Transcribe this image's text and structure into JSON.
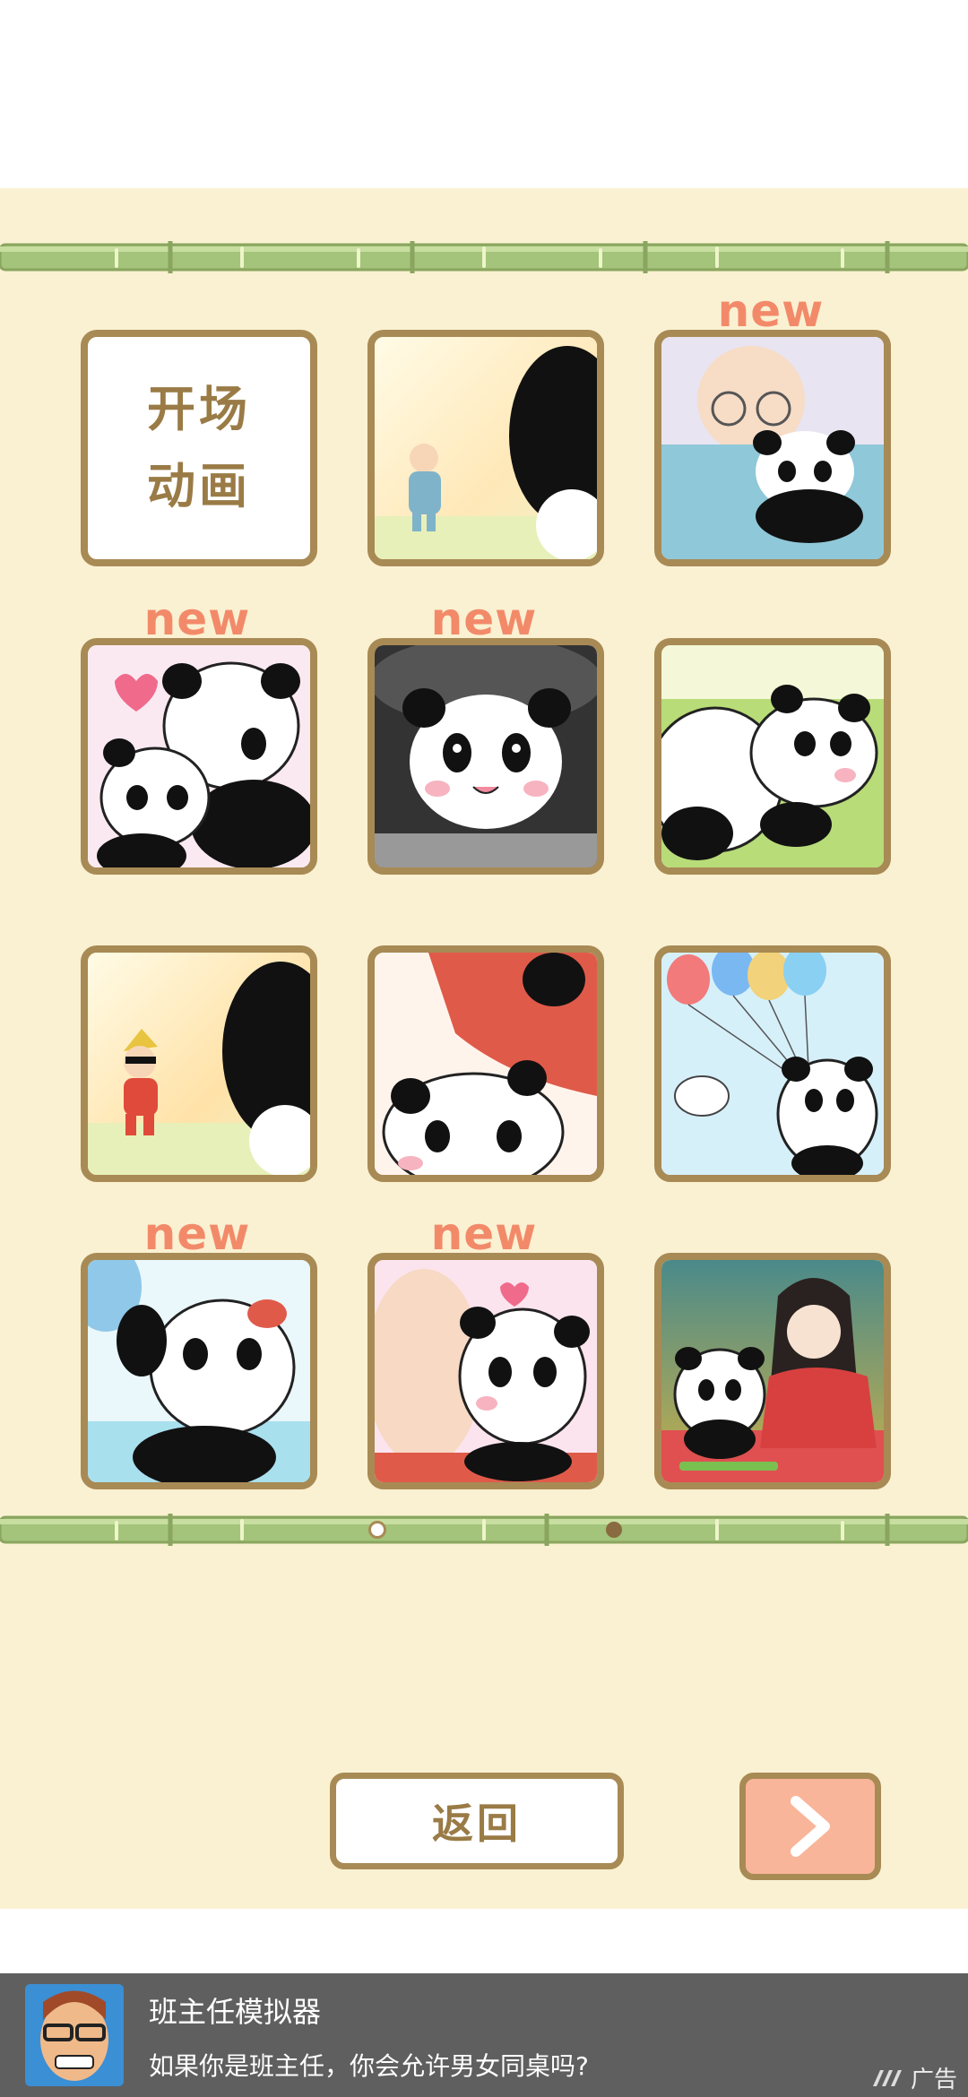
{
  "gallery": {
    "opening_tile_label": "开场动画",
    "opening_tile_line1": "开场",
    "opening_tile_line2": "动画",
    "new_badge": "new",
    "tiles": [
      {
        "id": "opening-animation",
        "is_new": false
      },
      {
        "id": "old-man-waving",
        "is_new": false
      },
      {
        "id": "old-man-hugging-panda",
        "is_new": true
      },
      {
        "id": "panda-mother-baby",
        "is_new": true
      },
      {
        "id": "panda-in-car",
        "is_new": true
      },
      {
        "id": "panda-lying-grass",
        "is_new": false
      },
      {
        "id": "guy-sunglasses-waving",
        "is_new": false
      },
      {
        "id": "panda-red-jacket",
        "is_new": false
      },
      {
        "id": "panda-balloons-bird",
        "is_new": false
      },
      {
        "id": "panda-sweating-leaf",
        "is_new": true
      },
      {
        "id": "panda-kiss",
        "is_new": true
      },
      {
        "id": "panda-kimono-girl",
        "is_new": false
      }
    ],
    "pagination": {
      "total": 2,
      "current": 1
    }
  },
  "nav": {
    "back_label": "返回",
    "next_icon": "chevron-right-icon"
  },
  "ad": {
    "title": "班主任模拟器",
    "text": "如果你是班主任，你会允许男女同桌吗?",
    "tag": "广告"
  },
  "colors": {
    "background": "#faf1d2",
    "frame": "#a88a55",
    "new_badge": "#f28a6a",
    "next_button": "#f9b59a",
    "bamboo": "#9bbf6f"
  }
}
